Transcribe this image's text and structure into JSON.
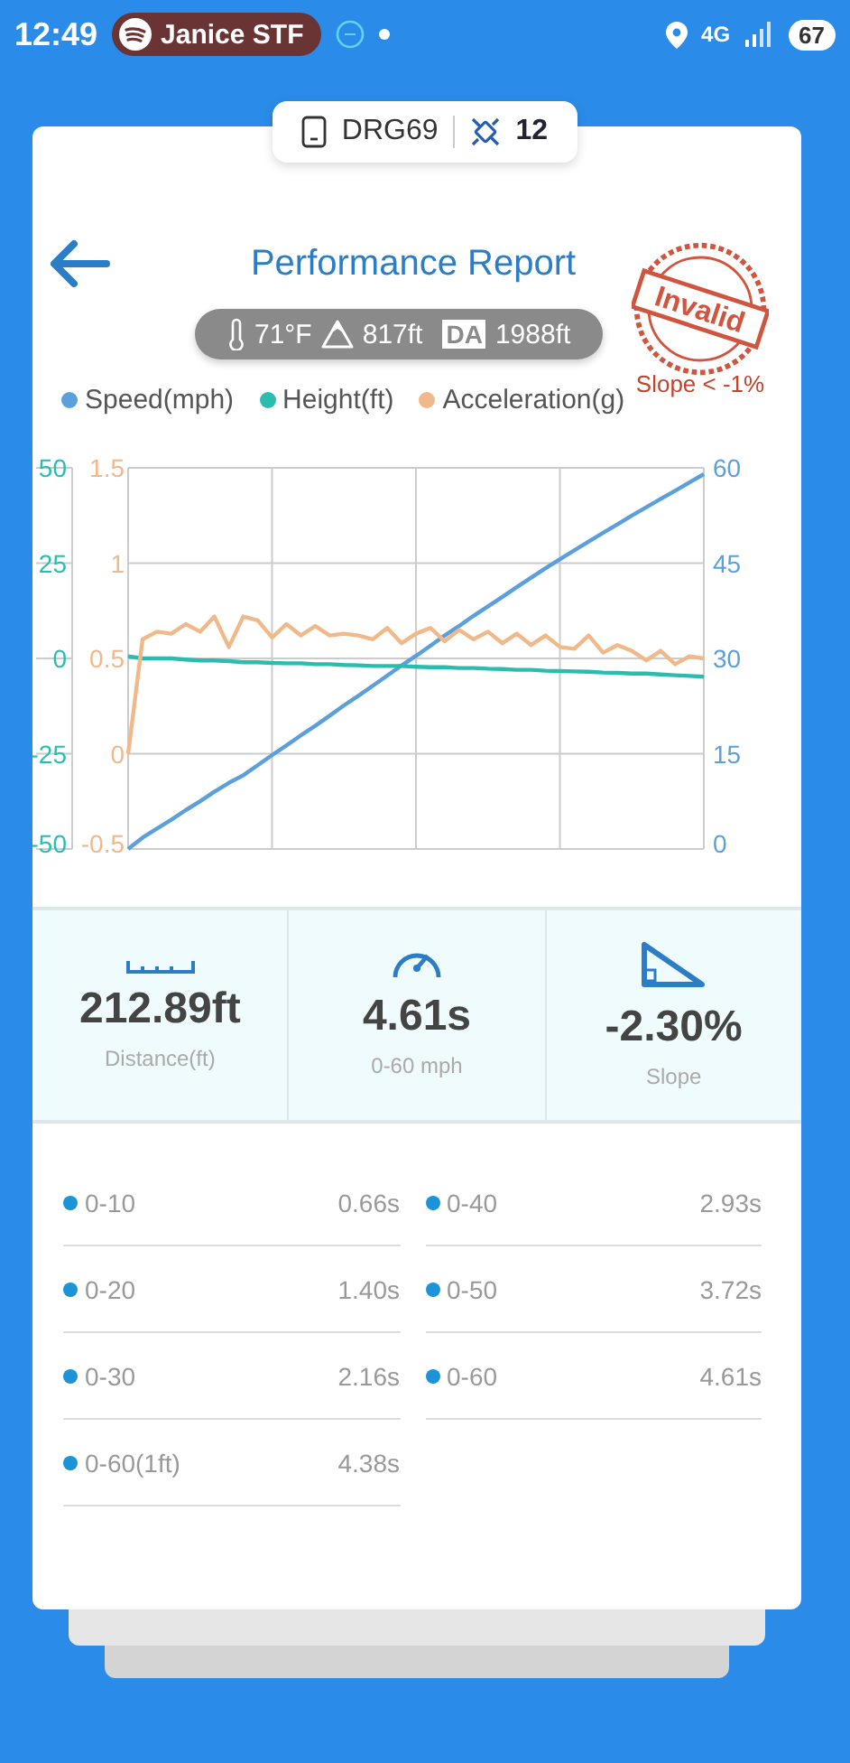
{
  "status_bar": {
    "time": "12:49",
    "media": {
      "label": "Janice STF"
    },
    "network": "4G",
    "battery": "67"
  },
  "device": {
    "name": "DRG69",
    "satellites": "12"
  },
  "header": {
    "title": "Performance Report"
  },
  "conditions": {
    "temperature": "71°F",
    "altitude": "817ft",
    "da_label": "DA",
    "density_altitude": "1988ft"
  },
  "stamp": {
    "label": "Invalid",
    "reason": "Slope < -1%"
  },
  "chart_data": {
    "type": "line",
    "categories": [
      null,
      null,
      null,
      null,
      null,
      null,
      null,
      null,
      null,
      null,
      null,
      null,
      null,
      null,
      null,
      null,
      null,
      null,
      null,
      null,
      null,
      null,
      null,
      null,
      null,
      null,
      null,
      null,
      null,
      null,
      null,
      null,
      null,
      null,
      null,
      null,
      null,
      null,
      null,
      null,
      null
    ],
    "grid": true,
    "ylim": [
      0,
      60
    ],
    "yticks": [
      60,
      45,
      30,
      15,
      0
    ],
    "y2lim": [
      -50,
      50
    ],
    "y2ticks": [
      50,
      25,
      0,
      -25,
      -50
    ],
    "y3lim": [
      -0.5,
      1.5
    ],
    "y3ticks": [
      1.5,
      1,
      0.5,
      0,
      -0.5
    ],
    "series": [
      {
        "name": "Speed(mph)",
        "color": "#5b9fdc",
        "axis": "y",
        "values": [
          0,
          1.8,
          3.2,
          4.6,
          6.1,
          7.5,
          9,
          10.4,
          11.6,
          13.2,
          14.8,
          16.3,
          17.9,
          19.4,
          21,
          22.6,
          24.1,
          25.7,
          27.3,
          28.9,
          30.4,
          32,
          33.6,
          35.1,
          36.7,
          38.2,
          39.7,
          41.2,
          42.7,
          44.2,
          45.6,
          47,
          48.4,
          49.8,
          51.1,
          52.5,
          53.8,
          55.1,
          56.4,
          57.7,
          59
        ]
      },
      {
        "name": "Height(ft)",
        "color": "#2bbcb0",
        "axis": "y2",
        "values": [
          0.5,
          0,
          0,
          0,
          -0.3,
          -0.5,
          -0.5,
          -0.7,
          -1,
          -1,
          -1.2,
          -1.3,
          -1.3,
          -1.5,
          -1.5,
          -1.7,
          -1.8,
          -2,
          -2,
          -2,
          -2.2,
          -2.3,
          -2.3,
          -2.5,
          -2.5,
          -2.7,
          -2.8,
          -3,
          -3,
          -3.2,
          -3.3,
          -3.4,
          -3.5,
          -3.7,
          -3.8,
          -4,
          -4,
          -4.2,
          -4.4,
          -4.6,
          -4.8
        ]
      },
      {
        "name": "Acceleration(g)",
        "color": "#f0b98a",
        "axis": "y3",
        "values": [
          0,
          0.6,
          0.64,
          0.63,
          0.68,
          0.64,
          0.72,
          0.56,
          0.72,
          0.7,
          0.61,
          0.68,
          0.62,
          0.67,
          0.62,
          0.63,
          0.62,
          0.6,
          0.66,
          0.58,
          0.63,
          0.66,
          0.59,
          0.65,
          0.6,
          0.64,
          0.58,
          0.63,
          0.57,
          0.62,
          0.56,
          0.55,
          0.62,
          0.53,
          0.57,
          0.54,
          0.49,
          0.54,
          0.47,
          0.51,
          0.5
        ]
      }
    ]
  },
  "stats": [
    {
      "kind": "distance",
      "value": "212.89ft",
      "label": "Distance(ft)"
    },
    {
      "kind": "time",
      "value": "4.61s",
      "label": "0-60 mph"
    },
    {
      "kind": "slope",
      "value": "-2.30%",
      "label": "Slope"
    }
  ],
  "splits": [
    {
      "label": "0-10",
      "time": "0.66s"
    },
    {
      "label": "0-40",
      "time": "2.93s"
    },
    {
      "label": "0-20",
      "time": "1.40s"
    },
    {
      "label": "0-50",
      "time": "3.72s"
    },
    {
      "label": "0-30",
      "time": "2.16s"
    },
    {
      "label": "0-60",
      "time": "4.61s"
    },
    {
      "label": "0-60(1ft)",
      "time": "4.38s"
    }
  ]
}
